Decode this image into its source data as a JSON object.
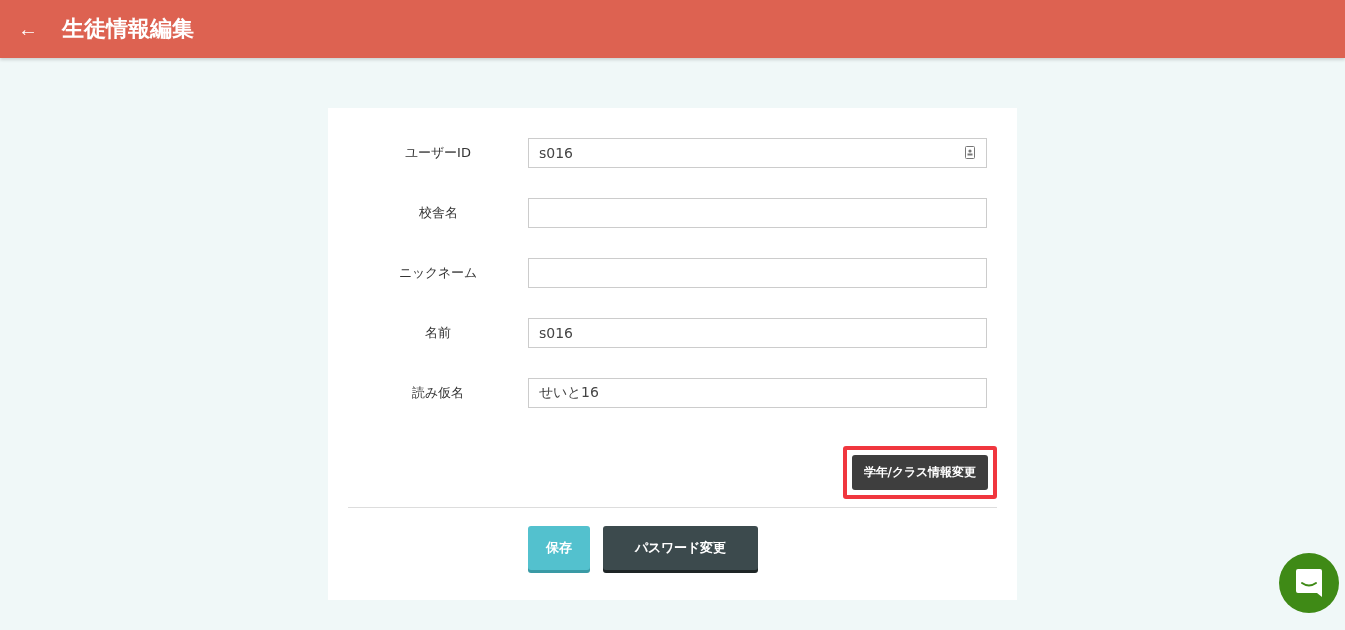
{
  "header": {
    "back": "←",
    "title": "生徒情報編集"
  },
  "fields": [
    {
      "label": "ユーザーID",
      "value": "s016",
      "kind": "contact"
    },
    {
      "label": "校舎名",
      "kind": "text"
    },
    {
      "label": "ニックネーム",
      "kind": "text"
    },
    {
      "label": "名前",
      "value": "s016",
      "kind": "text"
    },
    {
      "label": "読み仮名",
      "value": "せいと16",
      "kind": "text"
    }
  ],
  "class_button": {
    "label": "学年/クラス情報変更",
    "highlighted": true
  },
  "buttons": [
    {
      "label": "保存",
      "kind": "primary"
    },
    {
      "label": "パスワード変更",
      "kind": "dark"
    }
  ]
}
